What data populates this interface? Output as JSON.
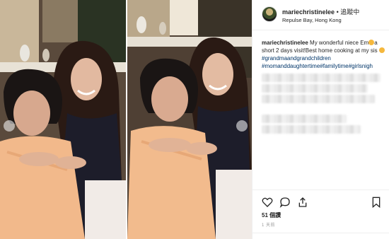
{
  "post": {
    "username": "mariechristinelee",
    "follow_separator": "•",
    "follow_label": "追蹤中",
    "location": "Repulse Bay, Hong Kong",
    "caption": {
      "text": "My wonderful niece Em",
      "text_cont": "a short 2 days visit!Best home cooking at my sis",
      "hashtags": "#grandmaandgrandchildren #momanddaughtertime#familytime#girlsnigh"
    },
    "likes_label": "51 個讚",
    "time_ago": "1 天前"
  },
  "icons": {
    "avatar": "avatar-icon",
    "like": "heart-icon",
    "comment": "comment-icon",
    "share": "share-icon",
    "save": "bookmark-icon",
    "carousel_prev": "chevron-left-icon",
    "carousel_next": "chevron-right-icon"
  },
  "colors": {
    "hashtag": "#003569",
    "text": "#262626",
    "muted": "#999999",
    "divider": "#efefef"
  }
}
